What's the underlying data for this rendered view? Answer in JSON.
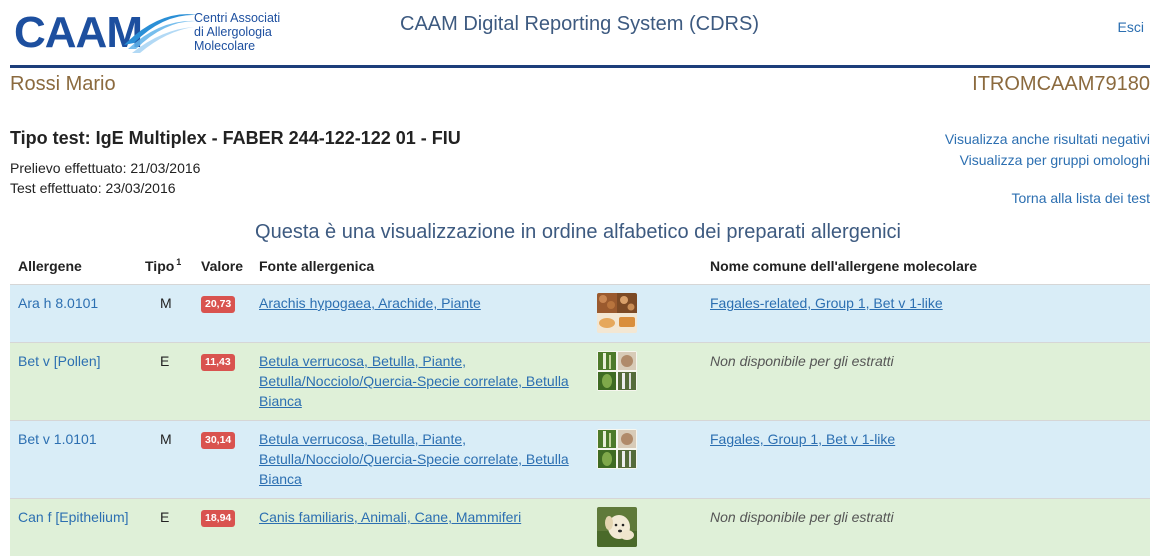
{
  "header": {
    "logo_text": "CAAM",
    "logo_sub": [
      "Centri Associati",
      "di Allergologia",
      "Molecolare"
    ],
    "app_title": "CAAM Digital Reporting System (CDRS)",
    "logout_label": "Esci"
  },
  "patient": {
    "name": "Rossi Mario",
    "code": "ITROMCAAM79180"
  },
  "test": {
    "type_line": "Tipo test: IgE Multiplex - FABER 244-122-122 01 - FIU",
    "sampling": "Prelievo effettuato: 21/03/2016",
    "performed": "Test effettuato: 23/03/2016"
  },
  "links": {
    "show_negative": "Visualizza anche risultati negativi",
    "show_groups": "Visualizza per gruppi omologhi",
    "back_to_list": "Torna alla lista dei test"
  },
  "info_text": "Questa è una visualizzazione in ordine alfabetico dei preparati allergenici",
  "table": {
    "headers": {
      "allergen": "Allergene",
      "type": "Tipo",
      "type_note": "1",
      "value": "Valore",
      "source": "Fonte allergenica",
      "name": "Nome comune dell'allergene molecolare"
    },
    "rows": [
      {
        "allergen": "Ara h 8.0101",
        "type": "M",
        "value": "20,73",
        "source": "Arachis hypogaea, Arachide, Piante",
        "name": "Fagales-related, Group 1, Bet v 1-like",
        "available": true,
        "thumb": "peanut-thumbnail",
        "bg": "blue"
      },
      {
        "allergen": "Bet v [Pollen]",
        "type": "E",
        "value": "11,43",
        "source": "Betula verrucosa, Betulla, Piante, Betulla/Nocciolo/Quercia-Specie correlate, Betulla Bianca",
        "name": "Non disponibile per gli estratti",
        "available": false,
        "thumb": "birch-thumbnail",
        "bg": "green"
      },
      {
        "allergen": "Bet v 1.0101",
        "type": "M",
        "value": "30,14",
        "source": "Betula verrucosa, Betulla, Piante, Betulla/Nocciolo/Quercia-Specie correlate, Betulla Bianca",
        "name": "Fagales, Group 1, Bet v 1-like",
        "available": true,
        "thumb": "birch-thumbnail",
        "bg": "blue"
      },
      {
        "allergen": "Can f [Epithelium]",
        "type": "E",
        "value": "18,94",
        "source": "Canis familiaris, Animali, Cane, Mammiferi",
        "name": "Non disponibile per gli estratti",
        "available": false,
        "thumb": "dog-thumbnail",
        "bg": "green"
      }
    ]
  },
  "colors": {
    "brand": "#1d4f9f",
    "link": "#2c6fb1",
    "value_badge": "#d9534f",
    "row_blue": "#d9edf7",
    "row_green": "#dff0d8",
    "patient_text": "#8b6a3e"
  }
}
